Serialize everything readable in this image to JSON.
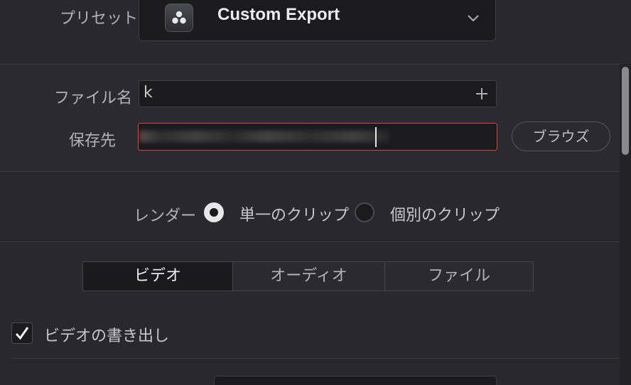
{
  "preset": {
    "label": "プリセット",
    "value": "Custom Export",
    "icon": "davinci-resolve-icon",
    "chevron_icon": "chevron-down-icon"
  },
  "file": {
    "filename_label": "ファイル名",
    "filename_value": "k",
    "add_icon": "plus-icon",
    "save_label": "保存先",
    "browse_label": "ブラウズ"
  },
  "render": {
    "label": "レンダー",
    "options": [
      {
        "label": "単一のクリップ",
        "selected": true
      },
      {
        "label": "個別のクリップ",
        "selected": false
      }
    ]
  },
  "tabs": [
    {
      "label": "ビデオ",
      "active": true
    },
    {
      "label": "オーディオ",
      "active": false
    },
    {
      "label": "ファイル",
      "active": false
    }
  ],
  "video": {
    "export_label": "ビデオの書き出し",
    "export_checked": true,
    "check_icon": "checkmark-icon"
  },
  "colors": {
    "background": "#28282e",
    "field": "#1b1b1e",
    "error_border": "#d9433d",
    "text": "#c8c8cc"
  }
}
